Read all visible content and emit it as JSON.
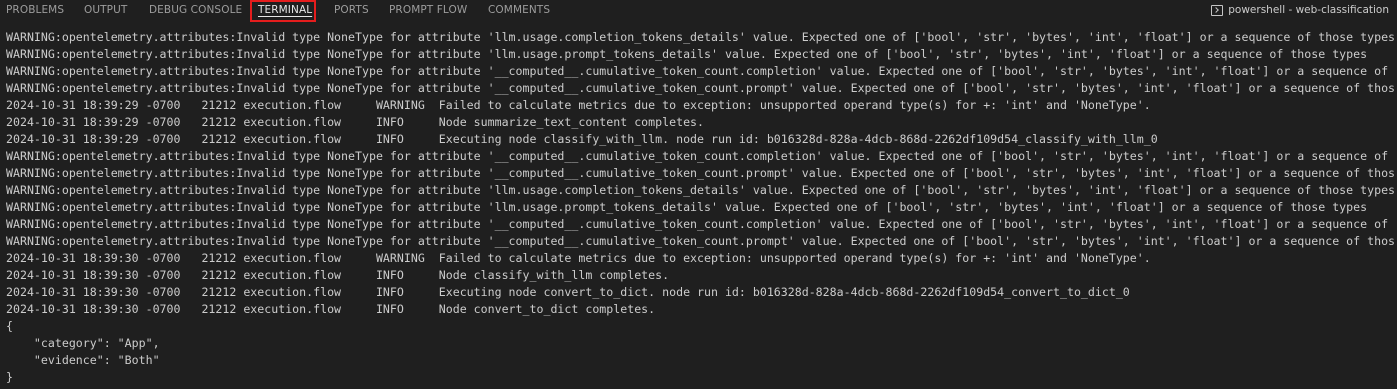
{
  "panel": {
    "tabs": [
      {
        "label": "PROBLEMS"
      },
      {
        "label": "OUTPUT"
      },
      {
        "label": "DEBUG CONSOLE"
      },
      {
        "label": "TERMINAL"
      },
      {
        "label": "PORTS"
      },
      {
        "label": "PROMPT FLOW"
      },
      {
        "label": "COMMENTS"
      }
    ],
    "active_tab": "TERMINAL",
    "terminal_name": "powershell - web-classification"
  },
  "terminal": {
    "lines": [
      "WARNING:opentelemetry.attributes:Invalid type NoneType for attribute 'llm.usage.completion_tokens_details' value. Expected one of ['bool', 'str', 'bytes', 'int', 'float'] or a sequence of those types",
      "WARNING:opentelemetry.attributes:Invalid type NoneType for attribute 'llm.usage.prompt_tokens_details' value. Expected one of ['bool', 'str', 'bytes', 'int', 'float'] or a sequence of those types",
      "WARNING:opentelemetry.attributes:Invalid type NoneType for attribute '__computed__.cumulative_token_count.completion' value. Expected one of ['bool', 'str', 'bytes', 'int', 'float'] or a sequence of",
      "WARNING:opentelemetry.attributes:Invalid type NoneType for attribute '__computed__.cumulative_token_count.prompt' value. Expected one of ['bool', 'str', 'bytes', 'int', 'float'] or a sequence of thos",
      "2024-10-31 18:39:29 -0700   21212 execution.flow     WARNING  Failed to calculate metrics due to exception: unsupported operand type(s) for +: 'int' and 'NoneType'.",
      "2024-10-31 18:39:29 -0700   21212 execution.flow     INFO     Node summarize_text_content completes.",
      "2024-10-31 18:39:29 -0700   21212 execution.flow     INFO     Executing node classify_with_llm. node run id: b016328d-828a-4dcb-868d-2262df109d54_classify_with_llm_0",
      "WARNING:opentelemetry.attributes:Invalid type NoneType for attribute '__computed__.cumulative_token_count.completion' value. Expected one of ['bool', 'str', 'bytes', 'int', 'float'] or a sequence of",
      "WARNING:opentelemetry.attributes:Invalid type NoneType for attribute '__computed__.cumulative_token_count.prompt' value. Expected one of ['bool', 'str', 'bytes', 'int', 'float'] or a sequence of thos",
      "WARNING:opentelemetry.attributes:Invalid type NoneType for attribute 'llm.usage.completion_tokens_details' value. Expected one of ['bool', 'str', 'bytes', 'int', 'float'] or a sequence of those types",
      "WARNING:opentelemetry.attributes:Invalid type NoneType for attribute 'llm.usage.prompt_tokens_details' value. Expected one of ['bool', 'str', 'bytes', 'int', 'float'] or a sequence of those types",
      "WARNING:opentelemetry.attributes:Invalid type NoneType for attribute '__computed__.cumulative_token_count.completion' value. Expected one of ['bool', 'str', 'bytes', 'int', 'float'] or a sequence of",
      "WARNING:opentelemetry.attributes:Invalid type NoneType for attribute '__computed__.cumulative_token_count.prompt' value. Expected one of ['bool', 'str', 'bytes', 'int', 'float'] or a sequence of thos",
      "2024-10-31 18:39:30 -0700   21212 execution.flow     WARNING  Failed to calculate metrics due to exception: unsupported operand type(s) for +: 'int' and 'NoneType'.",
      "2024-10-31 18:39:30 -0700   21212 execution.flow     INFO     Node classify_with_llm completes.",
      "2024-10-31 18:39:30 -0700   21212 execution.flow     INFO     Executing node convert_to_dict. node run id: b016328d-828a-4dcb-868d-2262df109d54_convert_to_dict_0",
      "2024-10-31 18:39:30 -0700   21212 execution.flow     INFO     Node convert_to_dict completes.",
      "{",
      "    \"category\": \"App\",",
      "    \"evidence\": \"Both\"",
      "}"
    ]
  },
  "colors": {
    "background": "#1f1f1f",
    "text": "#cccccc",
    "active_tab_highlight": "#e51d1d"
  }
}
